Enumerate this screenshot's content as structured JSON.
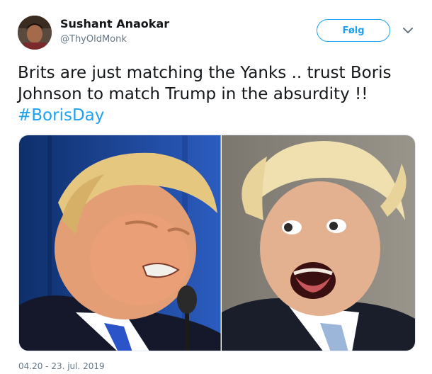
{
  "author": {
    "name": "Sushant Anaokar",
    "handle": "@ThyOldMonk"
  },
  "follow_button": {
    "label": "Følg"
  },
  "icons": {
    "caret": "chevron-down-icon"
  },
  "tweet": {
    "text": "Brits are just matching the Yanks .. trust Boris Johnson to match Trump in the absurdity !!",
    "hashtag": "#BorisDay"
  },
  "timestamp": "04.20 - 23. jul. 2019",
  "colors": {
    "accent": "#1da1f2",
    "text": "#14171a",
    "muted": "#657786"
  }
}
